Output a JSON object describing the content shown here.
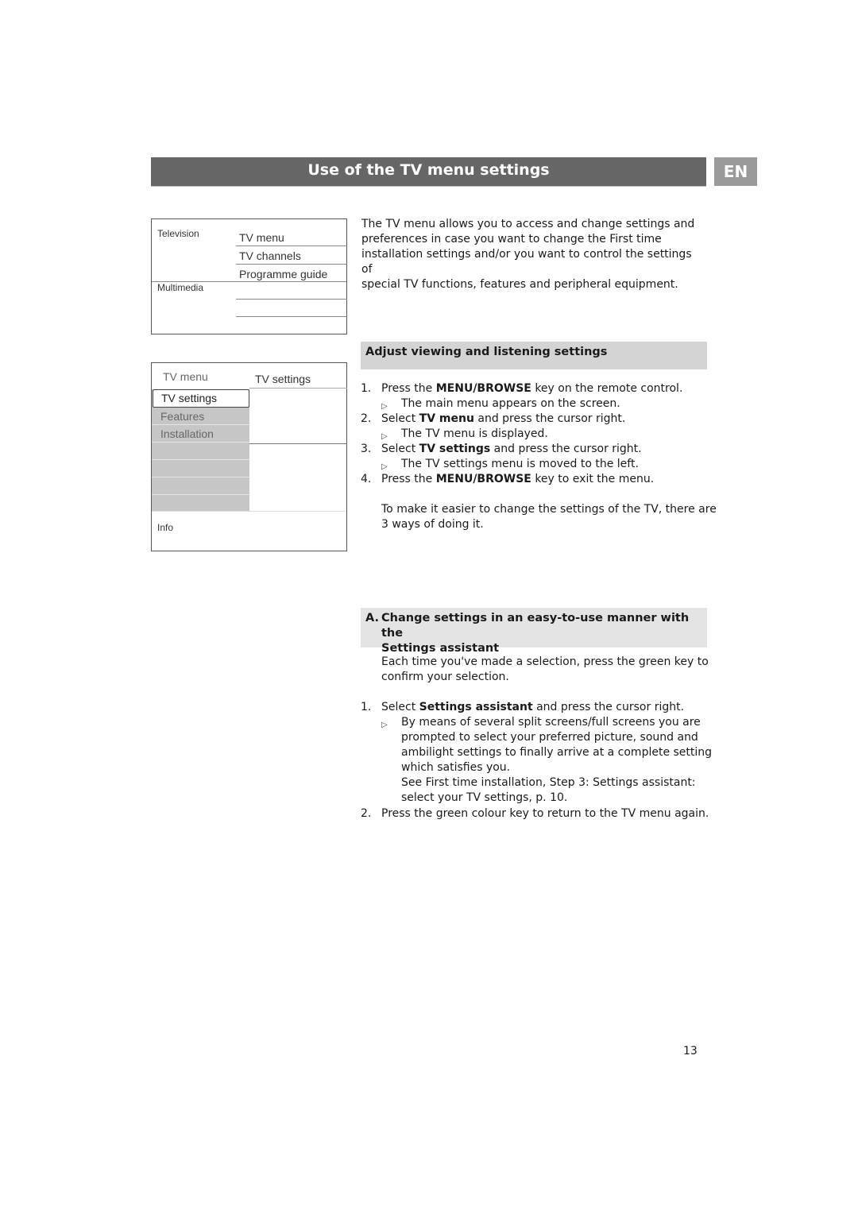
{
  "header": {
    "title": "Use of the TV menu settings",
    "language_badge": "EN"
  },
  "screen_main_menu": {
    "left_labels": [
      "Television",
      "Multimedia"
    ],
    "items": [
      "TV menu",
      "TV channels",
      "Programme guide",
      "",
      ""
    ]
  },
  "screen_tv_menu": {
    "header_left": "TV menu",
    "header_right": "TV settings",
    "selected_item": "TV settings",
    "items": [
      "Features",
      "Installation",
      "",
      "",
      "",
      ""
    ],
    "footer": "Info"
  },
  "intro": {
    "lines": [
      "The TV menu allows you to access and change settings and",
      "preferences in case you want to change the First time",
      "installation settings and/or you want to control the settings of",
      "special TV functions, features and peripheral equipment."
    ]
  },
  "section1": {
    "heading": "Adjust viewing and listening settings",
    "steps": [
      {
        "num": "1.",
        "pre": "Press the ",
        "bold": "MENU/BROWSE",
        "post": " key on the remote control.",
        "sub": "The main menu appears on the screen."
      },
      {
        "num": "2.",
        "pre": "Select ",
        "bold": "TV menu",
        "post": " and press the cursor right.",
        "sub": "The TV menu is displayed."
      },
      {
        "num": "3.",
        "pre": "Select ",
        "bold": "TV settings",
        "post": " and press the cursor right.",
        "sub": "The TV settings menu is moved to the left."
      },
      {
        "num": "4.",
        "pre": "Press the ",
        "bold": "MENU/BROWSE",
        "post": " key to exit the menu.",
        "sub": ""
      }
    ],
    "note_lines": [
      "To make it easier to change the settings of the TV, there are",
      "3 ways of doing it."
    ]
  },
  "section2": {
    "heading_prefix": "A.",
    "heading_line1": "Change settings in an easy-to-use manner with the",
    "heading_line2": "Settings assistant",
    "intro_lines": [
      "Each time you've made a selection, press the green key to",
      "confirm your selection."
    ],
    "step1": {
      "num": "1.",
      "pre": "Select ",
      "bold": "Settings assistant",
      "post": " and press the cursor right."
    },
    "step1_sub_lines": [
      "By means of several split screens/full screens you are",
      "prompted to select your preferred picture, sound and",
      "ambilight settings to finally arrive at a complete setting",
      "which satisfies you.",
      "See First time installation, Step 3: Settings assistant:",
      "select your TV settings, p. 10."
    ],
    "step2": {
      "num": "2.",
      "text": "Press the green colour key to return to the TV menu again."
    }
  },
  "footer": {
    "page_number": "13"
  }
}
